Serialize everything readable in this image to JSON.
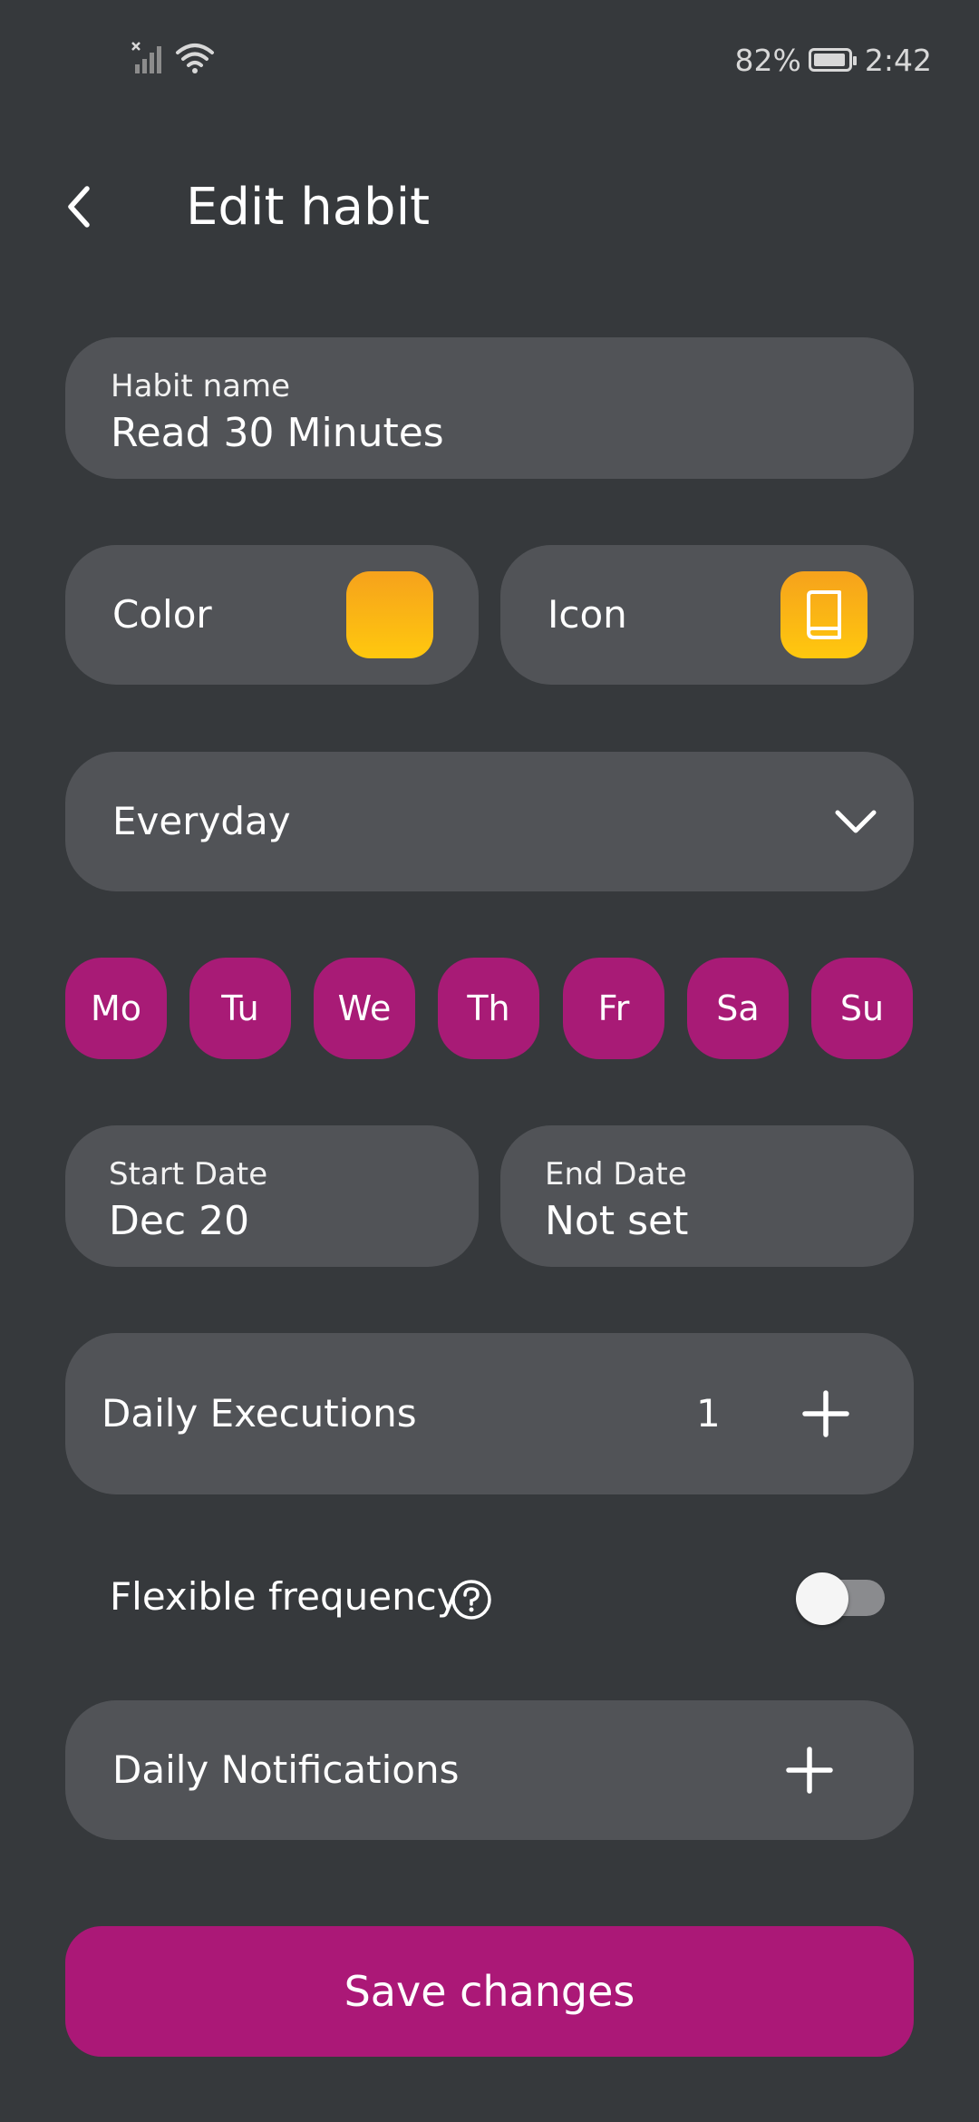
{
  "status_bar": {
    "battery_percent": "82%",
    "time": "2:42",
    "icons": [
      "signal-icon",
      "wifi-icon",
      "battery-icon"
    ]
  },
  "header": {
    "title": "Edit habit",
    "back_icon": "chevron-left-icon"
  },
  "habit_name": {
    "label": "Habit name",
    "value": "Read 30 Minutes"
  },
  "color": {
    "label": "Color",
    "value": "#f9b116"
  },
  "icon": {
    "label": "Icon",
    "name": "book-icon",
    "color": "#f9b116"
  },
  "frequency": {
    "selected": "Everyday"
  },
  "days": [
    "Mo",
    "Tu",
    "We",
    "Th",
    "Fr",
    "Sa",
    "Su"
  ],
  "dates": {
    "start_label": "Start Date",
    "start_value": "Dec 20",
    "end_label": "End Date",
    "end_value": "Not set"
  },
  "daily_executions": {
    "label": "Daily Executions",
    "count": "1"
  },
  "flexible_frequency": {
    "label": "Flexible frequency",
    "enabled": false
  },
  "daily_notifications": {
    "label": "Daily Notifications"
  },
  "save_button": {
    "label": "Save changes"
  },
  "colors": {
    "background": "#36393c",
    "card": "#515357",
    "accent": "#a81b76",
    "swatch": "#f9b116"
  }
}
